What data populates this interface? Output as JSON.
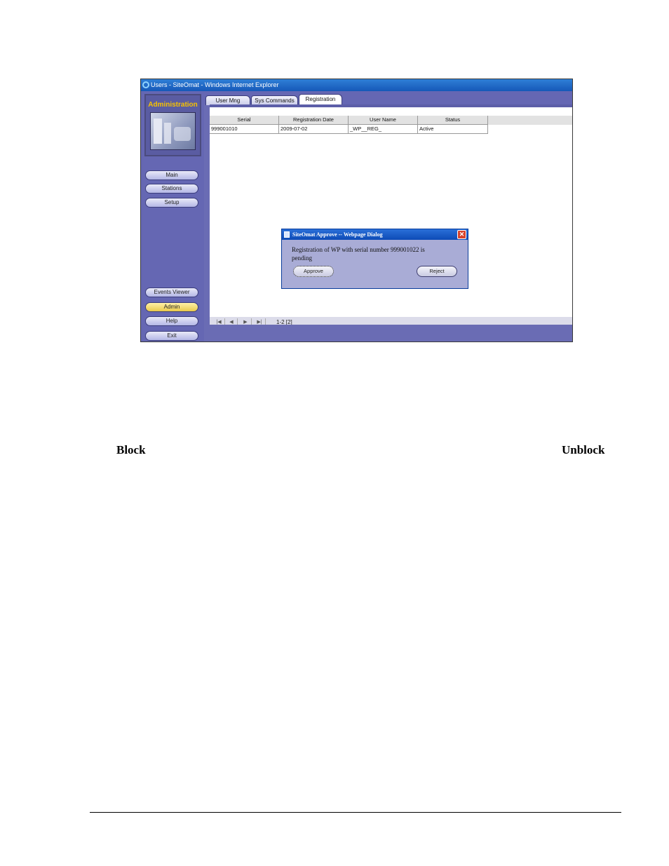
{
  "window": {
    "title": "Users - SiteOmat - Windows Internet Explorer"
  },
  "sidebar": {
    "logo_title": "Administration",
    "nav_items": [
      {
        "label": "Main",
        "active": false
      },
      {
        "label": "Stations",
        "active": false
      },
      {
        "label": "Setup",
        "active": false
      },
      {
        "label": "Events Viewer",
        "active": false
      },
      {
        "label": "Admin",
        "active": true
      },
      {
        "label": "Help",
        "active": false
      },
      {
        "label": "Exit",
        "active": false
      }
    ]
  },
  "tabs": [
    {
      "label": "User Mng",
      "selected": false
    },
    {
      "label": "Sys Commands",
      "selected": false
    },
    {
      "label": "Registration",
      "selected": true
    }
  ],
  "table": {
    "columns": [
      "Serial",
      "Registration Date",
      "User Name",
      "Status"
    ],
    "rows": [
      [
        "999001010",
        "2009-07-02",
        "_WP__REG_",
        "Active"
      ]
    ]
  },
  "pager": {
    "first_icon": "first-page-icon",
    "prev_icon": "prev-page-icon",
    "next_icon": "next-page-icon",
    "last_icon": "last-page-icon",
    "text": "1-2 [2]"
  },
  "dialog": {
    "title": "SiteOmat Approve -- Webpage Dialog",
    "message_line1": "Registration of WP with serial number 999001022 is",
    "message_line2": "pending",
    "approve_label": "Approve",
    "reject_label": "Reject",
    "close_symbol": "✕"
  },
  "document": {
    "left_word": "Block",
    "right_word": "Unblock"
  },
  "colors": {
    "sidebar": "#6567b3",
    "active_nav": "#e9c94a",
    "logo_title": "#f7c200",
    "title_bar": "#1658b8"
  }
}
